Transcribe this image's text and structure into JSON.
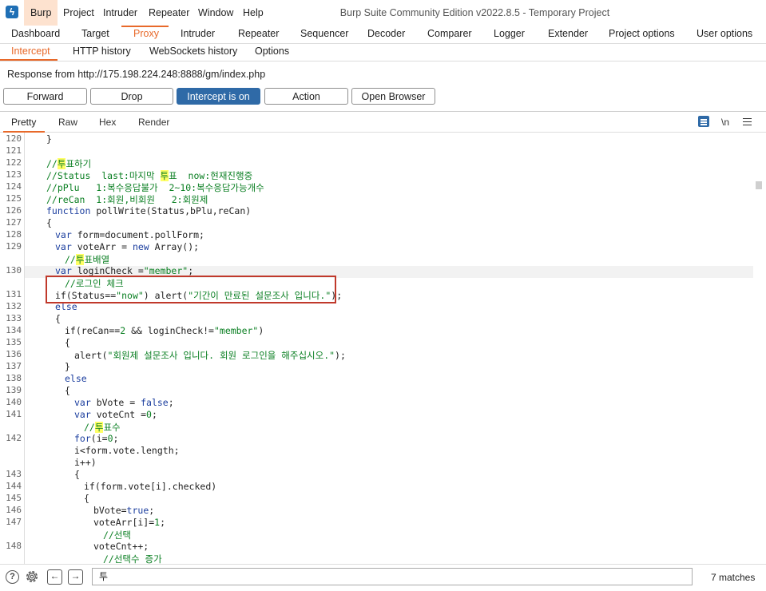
{
  "window": {
    "title": "Burp Suite Community Edition v2022.8.5 - Temporary Project",
    "menu": [
      "Burp",
      "Project",
      "Intruder",
      "Repeater",
      "Window",
      "Help"
    ]
  },
  "main_tabs": [
    "Dashboard",
    "Target",
    "Proxy",
    "Intruder",
    "Repeater",
    "Sequencer",
    "Decoder",
    "Comparer",
    "Logger",
    "Extender",
    "Project options",
    "User options"
  ],
  "proxy_tabs": [
    "Intercept",
    "HTTP history",
    "WebSockets history",
    "Options"
  ],
  "response_line": "Response from http://175.198.224.248:8888/gm/index.php",
  "buttons": {
    "forward": "Forward",
    "drop": "Drop",
    "intercept": "Intercept is on",
    "action": "Action",
    "open_browser": "Open Browser"
  },
  "editor_tabs": [
    "Pretty",
    "Raw",
    "Hex",
    "Render"
  ],
  "ln_toggle": "\\n",
  "code": {
    "line_numbers": [
      "120",
      "121",
      "122",
      "123",
      "124",
      "125",
      "126",
      "127",
      "128",
      "129",
      "130",
      "131",
      "132",
      "133",
      "134",
      "135",
      "136",
      "137",
      "138",
      "139",
      "140",
      "141",
      "142",
      "143",
      "144",
      "145",
      "146",
      "147",
      "148"
    ],
    "lines": {
      "l120": "}",
      "l122_a": "//",
      "l122_hl": "투",
      "l122_b": "표하기",
      "l123_a": "//Status  last:마지막 ",
      "l123_hl": "투",
      "l123_b": "표  now:현재진행중",
      "l124": "//pPlu   1:복수응답불가  2~10:복수응답가능개수",
      "l125": "//reCan  1:회원,비회원   2:회원제",
      "l126_kw": "function",
      "l126_b": " pollWrite(Status,bPlu,reCan)",
      "l127": "{",
      "l128_kw": "var",
      "l128_b": " form=document.pollForm;",
      "l129_kw": "var",
      "l129_b": " voteArr = ",
      "l129_kw2": "new",
      "l129_c": " Array();",
      "l129x_a": "//",
      "l129x_hl": "투",
      "l129x_b": "표배열",
      "l130_kw": "var",
      "l130_b": " loginCheck =",
      "l130_str": "\"member\"",
      "l130_c": ";",
      "l130x": "//로그인 체크",
      "l131_a": "if(Status==",
      "l131_str": "\"now\"",
      "l131_b": ") alert(",
      "l131_str2": "\"기간이 만료된 설문조사 입니다.\"",
      "l131_c": ");",
      "l132": "else",
      "l133": "{",
      "l134_a": "if(reCan==",
      "l134_num": "2",
      "l134_b": " && loginCheck!=",
      "l134_str": "\"member\"",
      "l134_c": ")",
      "l135": "{",
      "l136_a": "alert(",
      "l136_str": "\"회원제 설문조사 입니다. 회원 로그인을 해주십시오.\"",
      "l136_b": ");",
      "l137": "}",
      "l138": "else",
      "l139": "{",
      "l140_kw": "var",
      "l140_b": " bVote = ",
      "l140_kw2": "false",
      "l140_c": ";",
      "l141_kw": "var",
      "l141_b": " voteCnt =",
      "l141_num": "0",
      "l141_c": ";",
      "l141x_a": "//",
      "l141x_hl": "투",
      "l141x_b": "표수",
      "l142_kw": "for",
      "l142_b": "(i=",
      "l142_num": "0",
      "l142_c": ";",
      "l142x": "i<form.vote.length;",
      "l142y": "i++)",
      "l143": "{",
      "l144": "if(form.vote[i].checked)",
      "l145": "{",
      "l146_a": "bVote=",
      "l146_kw": "true",
      "l146_b": ";",
      "l147_a": "voteArr[i]=",
      "l147_num": "1",
      "l147_b": ";",
      "l147x": "//선택",
      "l148": "voteCnt++;",
      "l148x": "//선택수 증가"
    }
  },
  "search": {
    "value": "투",
    "matches": "7 matches"
  }
}
